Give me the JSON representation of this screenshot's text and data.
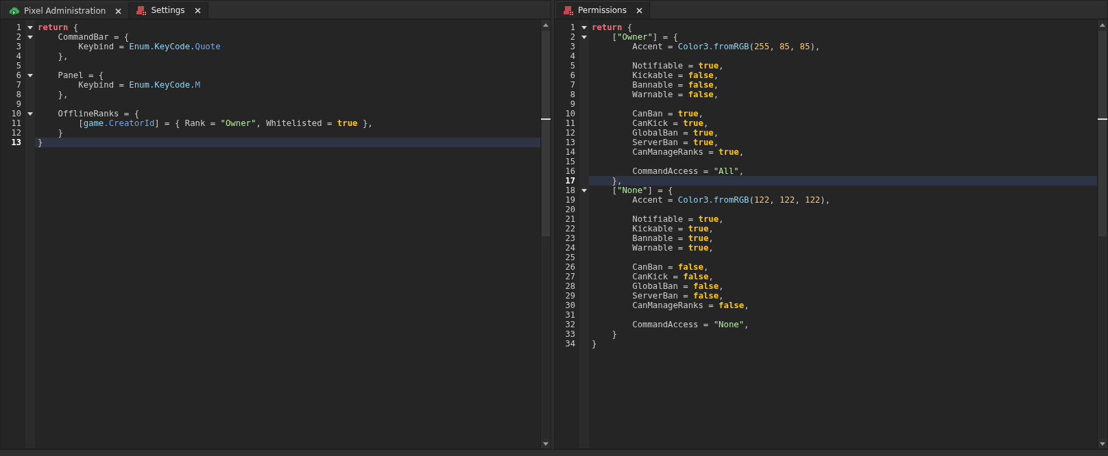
{
  "panes": [
    {
      "tabs": [
        {
          "label": "Pixel Administration",
          "kind": "plugin",
          "selected": false
        },
        {
          "label": "Settings",
          "kind": "script",
          "selected": true
        }
      ],
      "lines": [
        {
          "number": "1",
          "fold": true,
          "current": false,
          "tokens": [
            {
              "kind": "keyword",
              "text": "return"
            },
            {
              "kind": "text",
              "text": " {"
            }
          ]
        },
        {
          "number": "2",
          "fold": true,
          "current": false,
          "tokens": [
            {
              "kind": "text",
              "text": "    CommandBar = {"
            }
          ]
        },
        {
          "number": "3",
          "fold": false,
          "current": false,
          "tokens": [
            {
              "kind": "text",
              "text": "        Keybind = "
            },
            {
              "kind": "builtin",
              "text": "Enum.KeyCode."
            },
            {
              "kind": "member",
              "text": "Quote"
            }
          ]
        },
        {
          "number": "4",
          "fold": false,
          "current": false,
          "tokens": [
            {
              "kind": "text",
              "text": "    },"
            }
          ]
        },
        {
          "number": "5",
          "fold": false,
          "current": false
        },
        {
          "number": "6",
          "fold": true,
          "current": false,
          "tokens": [
            {
              "kind": "text",
              "text": "    Panel = {"
            }
          ]
        },
        {
          "number": "7",
          "fold": false,
          "current": false,
          "tokens": [
            {
              "kind": "text",
              "text": "        Keybind = "
            },
            {
              "kind": "builtin",
              "text": "Enum.KeyCode."
            },
            {
              "kind": "member",
              "text": "M"
            }
          ]
        },
        {
          "number": "8",
          "fold": false,
          "current": false,
          "tokens": [
            {
              "kind": "text",
              "text": "    },"
            }
          ]
        },
        {
          "number": "9",
          "fold": false,
          "current": false
        },
        {
          "number": "10",
          "fold": true,
          "current": false,
          "tokens": [
            {
              "kind": "text",
              "text": "    OfflineRanks = {"
            }
          ]
        },
        {
          "number": "11",
          "fold": false,
          "current": false,
          "tokens": [
            {
              "kind": "text",
              "text": "        ["
            },
            {
              "kind": "builtin",
              "text": "game"
            },
            {
              "kind": "member",
              "text": ".CreatorId"
            },
            {
              "kind": "text",
              "text": "] = { Rank = "
            },
            {
              "kind": "string",
              "text": "\"Owner\""
            },
            {
              "kind": "text",
              "text": ", Whitelisted = "
            },
            {
              "kind": "bool",
              "text": "true"
            },
            {
              "kind": "text",
              "text": " },"
            }
          ]
        },
        {
          "number": "12",
          "fold": false,
          "current": false,
          "tokens": [
            {
              "kind": "text",
              "text": "    }"
            }
          ]
        },
        {
          "number": "13",
          "fold": false,
          "current": true,
          "tokens": [
            {
              "kind": "text",
              "text": "}"
            }
          ]
        }
      ]
    },
    {
      "tabs": [
        {
          "label": "Permissions",
          "kind": "script",
          "selected": true
        }
      ],
      "lines": [
        {
          "number": "1",
          "fold": true,
          "current": false,
          "tokens": [
            {
              "kind": "keyword",
              "text": "return"
            },
            {
              "kind": "text",
              "text": " {"
            }
          ]
        },
        {
          "number": "2",
          "fold": true,
          "current": false,
          "tokens": [
            {
              "kind": "text",
              "text": "    ["
            },
            {
              "kind": "string",
              "text": "\"Owner\""
            },
            {
              "kind": "text",
              "text": "] = {"
            }
          ]
        },
        {
          "number": "3",
          "fold": false,
          "current": false,
          "tokens": [
            {
              "kind": "text",
              "text": "        Accent = "
            },
            {
              "kind": "builtin",
              "text": "Color3.fromRGB"
            },
            {
              "kind": "text",
              "text": "("
            },
            {
              "kind": "number",
              "text": "255"
            },
            {
              "kind": "text",
              "text": ", "
            },
            {
              "kind": "number",
              "text": "85"
            },
            {
              "kind": "text",
              "text": ", "
            },
            {
              "kind": "number",
              "text": "85"
            },
            {
              "kind": "text",
              "text": "),"
            }
          ]
        },
        {
          "number": "4",
          "fold": false,
          "current": false
        },
        {
          "number": "5",
          "fold": false,
          "current": false,
          "tokens": [
            {
              "kind": "text",
              "text": "        Notifiable = "
            },
            {
              "kind": "bool",
              "text": "true"
            },
            {
              "kind": "text",
              "text": ","
            }
          ]
        },
        {
          "number": "6",
          "fold": false,
          "current": false,
          "tokens": [
            {
              "kind": "text",
              "text": "        Kickable = "
            },
            {
              "kind": "bool",
              "text": "false"
            },
            {
              "kind": "text",
              "text": ","
            }
          ]
        },
        {
          "number": "7",
          "fold": false,
          "current": false,
          "tokens": [
            {
              "kind": "text",
              "text": "        Bannable = "
            },
            {
              "kind": "bool",
              "text": "false"
            },
            {
              "kind": "text",
              "text": ","
            }
          ]
        },
        {
          "number": "8",
          "fold": false,
          "current": false,
          "tokens": [
            {
              "kind": "text",
              "text": "        Warnable = "
            },
            {
              "kind": "bool",
              "text": "false"
            },
            {
              "kind": "text",
              "text": ","
            }
          ]
        },
        {
          "number": "9",
          "fold": false,
          "current": false
        },
        {
          "number": "10",
          "fold": false,
          "current": false,
          "tokens": [
            {
              "kind": "text",
              "text": "        CanBan = "
            },
            {
              "kind": "bool",
              "text": "true"
            },
            {
              "kind": "text",
              "text": ","
            }
          ]
        },
        {
          "number": "11",
          "fold": false,
          "current": false,
          "tokens": [
            {
              "kind": "text",
              "text": "        CanKick = "
            },
            {
              "kind": "bool",
              "text": "true"
            },
            {
              "kind": "text",
              "text": ","
            }
          ]
        },
        {
          "number": "12",
          "fold": false,
          "current": false,
          "tokens": [
            {
              "kind": "text",
              "text": "        GlobalBan = "
            },
            {
              "kind": "bool",
              "text": "true"
            },
            {
              "kind": "text",
              "text": ","
            }
          ]
        },
        {
          "number": "13",
          "fold": false,
          "current": false,
          "tokens": [
            {
              "kind": "text",
              "text": "        ServerBan = "
            },
            {
              "kind": "bool",
              "text": "true"
            },
            {
              "kind": "text",
              "text": ","
            }
          ]
        },
        {
          "number": "14",
          "fold": false,
          "current": false,
          "tokens": [
            {
              "kind": "text",
              "text": "        CanManageRanks = "
            },
            {
              "kind": "bool",
              "text": "true"
            },
            {
              "kind": "text",
              "text": ","
            }
          ]
        },
        {
          "number": "15",
          "fold": false,
          "current": false
        },
        {
          "number": "16",
          "fold": false,
          "current": false,
          "tokens": [
            {
              "kind": "text",
              "text": "        CommandAccess = "
            },
            {
              "kind": "string",
              "text": "\"All\""
            },
            {
              "kind": "text",
              "text": ","
            }
          ]
        },
        {
          "number": "17",
          "fold": false,
          "current": true,
          "tokens": [
            {
              "kind": "text",
              "text": "    },"
            }
          ]
        },
        {
          "number": "18",
          "fold": true,
          "current": false,
          "tokens": [
            {
              "kind": "text",
              "text": "    ["
            },
            {
              "kind": "string",
              "text": "\"None\""
            },
            {
              "kind": "text",
              "text": "] = {"
            }
          ]
        },
        {
          "number": "19",
          "fold": false,
          "current": false,
          "tokens": [
            {
              "kind": "text",
              "text": "        Accent = "
            },
            {
              "kind": "builtin",
              "text": "Color3.fromRGB"
            },
            {
              "kind": "text",
              "text": "("
            },
            {
              "kind": "number",
              "text": "122"
            },
            {
              "kind": "text",
              "text": ", "
            },
            {
              "kind": "number",
              "text": "122"
            },
            {
              "kind": "text",
              "text": ", "
            },
            {
              "kind": "number",
              "text": "122"
            },
            {
              "kind": "text",
              "text": "),"
            }
          ]
        },
        {
          "number": "20",
          "fold": false,
          "current": false
        },
        {
          "number": "21",
          "fold": false,
          "current": false,
          "tokens": [
            {
              "kind": "text",
              "text": "        Notifiable = "
            },
            {
              "kind": "bool",
              "text": "true"
            },
            {
              "kind": "text",
              "text": ","
            }
          ]
        },
        {
          "number": "22",
          "fold": false,
          "current": false,
          "tokens": [
            {
              "kind": "text",
              "text": "        Kickable = "
            },
            {
              "kind": "bool",
              "text": "true"
            },
            {
              "kind": "text",
              "text": ","
            }
          ]
        },
        {
          "number": "23",
          "fold": false,
          "current": false,
          "tokens": [
            {
              "kind": "text",
              "text": "        Bannable = "
            },
            {
              "kind": "bool",
              "text": "true"
            },
            {
              "kind": "text",
              "text": ","
            }
          ]
        },
        {
          "number": "24",
          "fold": false,
          "current": false,
          "tokens": [
            {
              "kind": "text",
              "text": "        Warnable = "
            },
            {
              "kind": "bool",
              "text": "true"
            },
            {
              "kind": "text",
              "text": ","
            }
          ]
        },
        {
          "number": "25",
          "fold": false,
          "current": false
        },
        {
          "number": "26",
          "fold": false,
          "current": false,
          "tokens": [
            {
              "kind": "text",
              "text": "        CanBan = "
            },
            {
              "kind": "bool",
              "text": "false"
            },
            {
              "kind": "text",
              "text": ","
            }
          ]
        },
        {
          "number": "27",
          "fold": false,
          "current": false,
          "tokens": [
            {
              "kind": "text",
              "text": "        CanKick = "
            },
            {
              "kind": "bool",
              "text": "false"
            },
            {
              "kind": "text",
              "text": ","
            }
          ]
        },
        {
          "number": "28",
          "fold": false,
          "current": false,
          "tokens": [
            {
              "kind": "text",
              "text": "        GlobalBan = "
            },
            {
              "kind": "bool",
              "text": "false"
            },
            {
              "kind": "text",
              "text": ","
            }
          ]
        },
        {
          "number": "29",
          "fold": false,
          "current": false,
          "tokens": [
            {
              "kind": "text",
              "text": "        ServerBan = "
            },
            {
              "kind": "bool",
              "text": "false"
            },
            {
              "kind": "text",
              "text": ","
            }
          ]
        },
        {
          "number": "30",
          "fold": false,
          "current": false,
          "tokens": [
            {
              "kind": "text",
              "text": "        CanManageRanks = "
            },
            {
              "kind": "bool",
              "text": "false"
            },
            {
              "kind": "text",
              "text": ","
            }
          ]
        },
        {
          "number": "31",
          "fold": false,
          "current": false
        },
        {
          "number": "32",
          "fold": false,
          "current": false,
          "tokens": [
            {
              "kind": "text",
              "text": "        CommandAccess = "
            },
            {
              "kind": "string",
              "text": "\"None\""
            },
            {
              "kind": "text",
              "text": ","
            }
          ]
        },
        {
          "number": "33",
          "fold": false,
          "current": false,
          "tokens": [
            {
              "kind": "text",
              "text": "    }"
            }
          ]
        },
        {
          "number": "34",
          "fold": false,
          "current": false,
          "tokens": [
            {
              "kind": "text",
              "text": "}"
            }
          ]
        }
      ]
    }
  ]
}
